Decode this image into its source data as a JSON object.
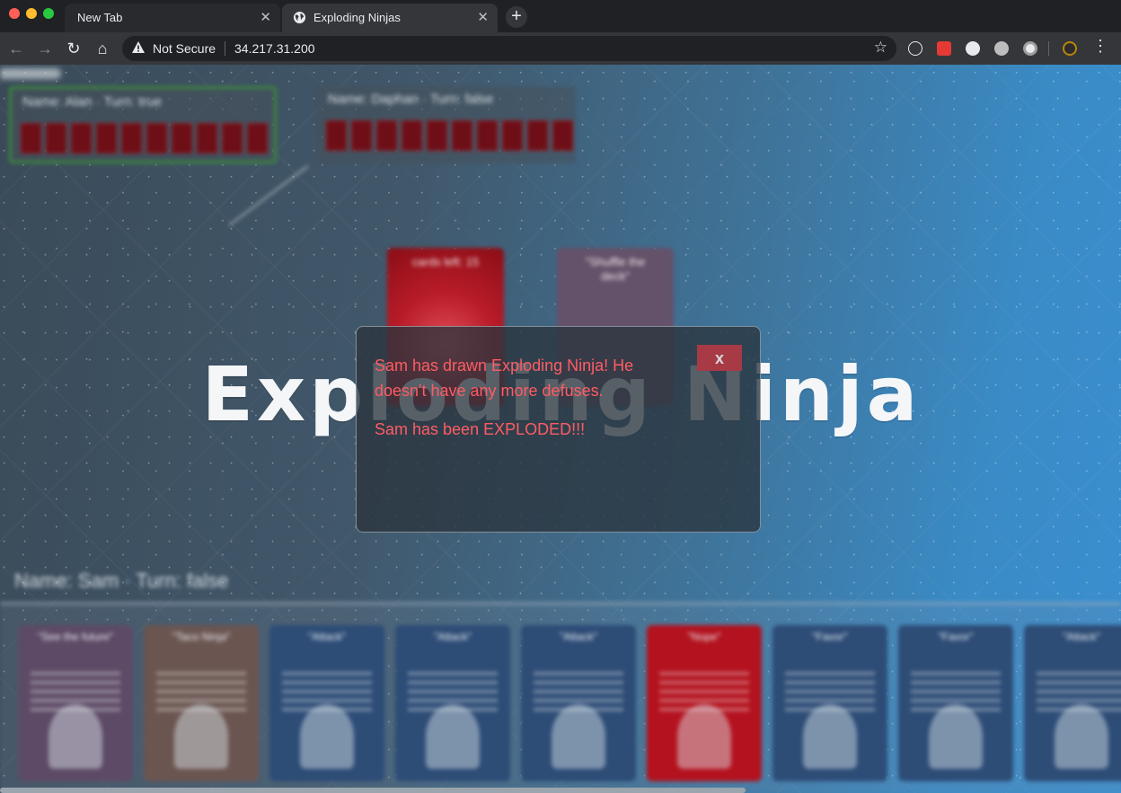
{
  "browser": {
    "tabs": [
      {
        "title": "New Tab",
        "active": false
      },
      {
        "title": "Exploding Ninjas",
        "active": true
      }
    ],
    "security_label": "Not Secure",
    "url": "34.217.31.200",
    "icons": [
      "back-icon",
      "forward-icon",
      "reload-icon",
      "home-icon",
      "warning-icon",
      "star-icon",
      "react-devtools-icon",
      "extension-red-icon",
      "extension-c-icon",
      "extension-s-icon",
      "extension-circle-icon",
      "extension-gold-icon",
      "menu-icon"
    ]
  },
  "game": {
    "title": "Exploding Ninja",
    "players": [
      {
        "label": "Name: Alan · Turn: true"
      },
      {
        "label": "Name: Daphan · Turn: false"
      }
    ],
    "deck": {
      "cards_left_label": "cards left: 15",
      "discard_label": "\"Shuffle the deck\""
    },
    "hand": {
      "label": "Name: Sam · Turn: false",
      "cards": [
        {
          "label": "\"See the future\"",
          "color": "#5d4a66"
        },
        {
          "label": "\"Taco Ninja\"",
          "color": "#6b5550"
        },
        {
          "label": "\"Attack\"",
          "color": "#2d4c76"
        },
        {
          "label": "\"Attack\"",
          "color": "#2d4c76"
        },
        {
          "label": "\"Attack\"",
          "color": "#2d4c76"
        },
        {
          "label": "\"Nope\"",
          "color": "#b3121e"
        },
        {
          "label": "\"Favor\"",
          "color": "#2d4c76"
        },
        {
          "label": "\"Favor\"",
          "color": "#2d4c76"
        },
        {
          "label": "\"Attack\"",
          "color": "#2d4c76"
        }
      ]
    }
  },
  "modal": {
    "close_label": "x",
    "message_1": "Sam has drawn Exploding Ninja! He doesn't have any more defuses.",
    "message_2": "Sam has been EXPLODED!!!"
  },
  "colors": {
    "message_text": "#ff5c64",
    "close_button": "#a83a46",
    "active_player_border": "#3c8a3c"
  }
}
